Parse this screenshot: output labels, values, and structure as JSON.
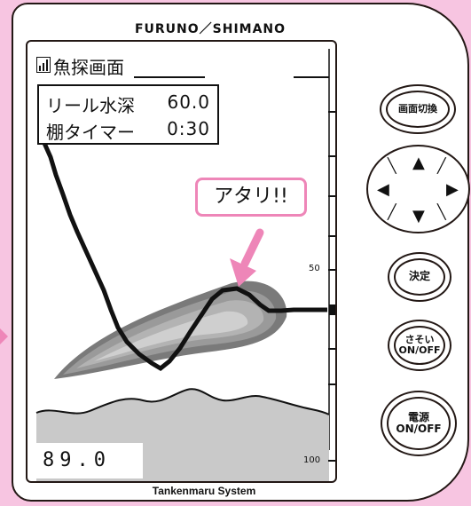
{
  "brand": "FURUNO／SHIMANO",
  "footer": "Tankenmaru System",
  "screen": {
    "title": "魚探画面",
    "reel_depth_label": "リール水深",
    "reel_depth_value": "60.0",
    "tana_timer_label": "棚タイマー",
    "tana_timer_value": "0:30",
    "readout": "89.0",
    "depth_mark_50": "50",
    "depth_mark_100": "100",
    "callout": "アタリ!!"
  },
  "buttons": {
    "screen_switch": "画面切換",
    "confirm": "決定",
    "sasoi_line1": "さそい",
    "sasoi_line2": "ON/OFF",
    "power_line1": "電源",
    "power_line2": "ON/OFF"
  },
  "icons": {
    "signal": "signal-bars-icon",
    "arrow_up": "arrow-up-icon",
    "arrow_down": "arrow-down-icon",
    "arrow_left": "arrow-left-icon",
    "arrow_right": "arrow-right-icon",
    "callout_arrow": "pointer-arrow-icon",
    "reel_marker": "reel-marker-icon"
  },
  "colors": {
    "background_pink": "#f7c5e1",
    "accent_pink": "#ee86b8",
    "outline": "#231815",
    "seabed_gray": "#c9c9c9"
  }
}
